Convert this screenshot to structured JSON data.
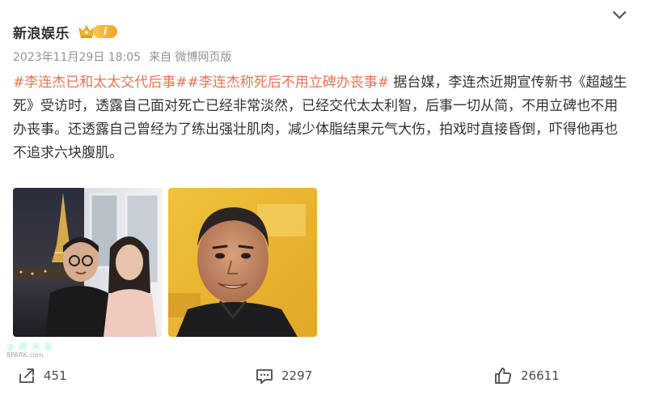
{
  "post": {
    "author": "新浪娱乐",
    "vip_level": "i",
    "timestamp": "2023年11月29日 18:05",
    "source": "来自 微博网页版",
    "topic1": "#李连杰已和太太交代后事#",
    "topic2": "#李连杰称死后不用立碑办丧事#",
    "body": " 据台媒，李连杰近期宣传新书《超越生死》受访时，透露自己面对死亡已经非常淡然，已经交代太太利智，后事一切从简，不用立碑也不用办丧事。还透露自己曾经为了练出强壮肌肉，减少体脂结果元气大伤，拍戏时直接昏倒，吓得他再也不追求六块腹肌。"
  },
  "images": [
    {
      "name": "photo-couple-paris-night"
    },
    {
      "name": "photo-portrait-closeup"
    }
  ],
  "watermark": {
    "cn": "@ 同 乐 区",
    "en": "8PARK.com"
  },
  "actions": {
    "repost_count": "451",
    "comment_count": "2297",
    "like_count": "26611"
  },
  "colors": {
    "topic": "#eb7350",
    "meta": "#939393",
    "icon": "#4b4b4b"
  },
  "icons": {
    "menu": "chevron-down-icon",
    "vip": "crown-icon",
    "repost": "repost-icon",
    "comment": "comment-icon",
    "like": "thumbs-up-icon"
  }
}
